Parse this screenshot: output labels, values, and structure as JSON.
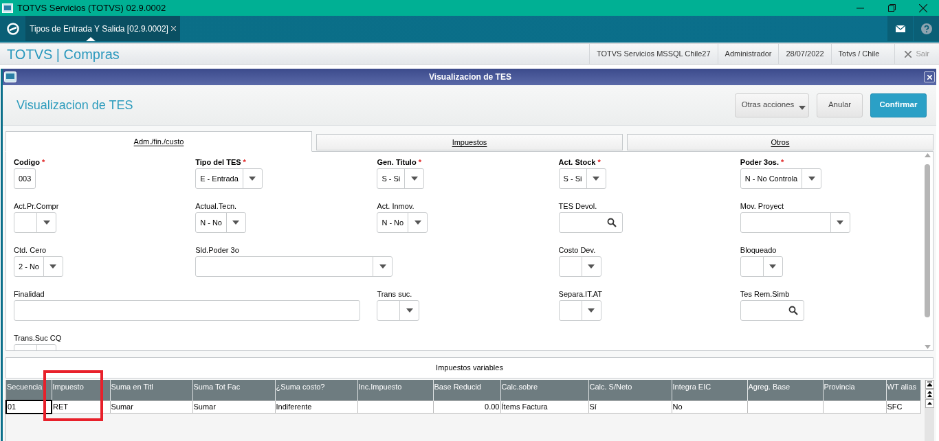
{
  "window": {
    "title": "TOTVS Servicios (TOTVS) 02.9.0002"
  },
  "app_tabs": [
    {
      "label": "Tipos de Entrada Y Salida [02.9.0002]",
      "selected": true
    }
  ],
  "header": {
    "title": "TOTVS | Compras",
    "info": [
      "TOTVS Servicios MSSQL Chile27",
      "Administrador",
      "28/07/2022",
      "Totvs / Chile"
    ],
    "exit": "Sair"
  },
  "dialog": {
    "title": "Visualizacion de TES",
    "heading": "Visualizacion de TES",
    "buttons": [
      {
        "label": "Otras acciones",
        "kind": "menu"
      },
      {
        "label": "Anular",
        "kind": "plain"
      },
      {
        "label": "Confirmar",
        "kind": "primary"
      }
    ]
  },
  "tabs": [
    {
      "label": "Adm./fin./custo",
      "selected": true
    },
    {
      "label": "Impuestos",
      "selected": false
    },
    {
      "label": "Otros",
      "selected": false
    }
  ],
  "fields": [
    {
      "label": "Codigo",
      "required_mark": "*",
      "kind": "text",
      "value": "003"
    },
    {
      "label": "Tipo del TES",
      "required_mark": "*",
      "kind": "select",
      "value": "E - Entrada"
    },
    {
      "label": "Gen. Titulo",
      "required_mark": "*",
      "kind": "select",
      "value": "S - Si"
    },
    {
      "label": "Act. Stock",
      "required_mark": "*",
      "kind": "select",
      "value": "S - Si"
    },
    {
      "label": "Poder 3os.",
      "required_mark": "*",
      "kind": "select",
      "value": "N - No Controla"
    },
    {
      "label": "Act.Pr.Compr",
      "kind": "select"
    },
    {
      "label": "Actual.Tecn.",
      "kind": "select",
      "value": "N - No"
    },
    {
      "label": "Act. Inmov.",
      "kind": "select",
      "value": "N - No"
    },
    {
      "label": "TES Devol.",
      "kind": "lookup"
    },
    {
      "label": "Mov. Proyect",
      "kind": "select-long"
    },
    {
      "label": "Ctd. Cero",
      "kind": "select",
      "value": "2 - No"
    },
    {
      "label": "Sld.Poder 3o",
      "kind": "select-wide"
    },
    {
      "label": "Costo Dev.",
      "kind": "select"
    },
    {
      "label": "Bloqueado",
      "kind": "select"
    },
    {
      "label": "Finalidad",
      "kind": "text-wide"
    },
    {
      "label": "Trans suc.",
      "kind": "select"
    },
    {
      "label": "Separa.IT.AT",
      "kind": "select"
    },
    {
      "label": "Tes Rem.Simb",
      "kind": "lookup"
    },
    {
      "label": "Trans.Suc CQ",
      "kind": "select"
    }
  ],
  "grid": {
    "title": "Impuestos variables",
    "columns": [
      {
        "label": "Secuencia",
        "highlighted": false
      },
      {
        "label": "Impuesto",
        "highlighted": true
      },
      {
        "label": "Suma en Titl",
        "highlighted": false
      },
      {
        "label": "Suma Tot Fac",
        "highlighted": false
      },
      {
        "label": "¿Suma costo?",
        "highlighted": false
      },
      {
        "label": "Inc.Impuesto",
        "highlighted": false
      },
      {
        "label": "Base Reducid",
        "highlighted": false
      },
      {
        "label": "Calc.sobre",
        "highlighted": false
      },
      {
        "label": "Calc. S/Neto",
        "highlighted": false
      },
      {
        "label": "Integra EIC",
        "highlighted": false
      },
      {
        "label": "Agreg. Base",
        "highlighted": false
      },
      {
        "label": "Provincia",
        "highlighted": false
      },
      {
        "label": "WT alias",
        "highlighted": false
      }
    ],
    "rows": [
      {
        "cells": [
          {
            "text": "01",
            "focused": true
          },
          {
            "text": "RET",
            "focused": false
          },
          {
            "text": "Sumar",
            "focused": false
          },
          {
            "text": "Sumar",
            "focused": false
          },
          {
            "text": "Indiferente",
            "focused": false
          },
          {
            "text": "",
            "focused": false
          },
          {
            "text": "0.00",
            "focused": false
          },
          {
            "text": "Ítems Factura",
            "focused": false
          },
          {
            "text": "Sí",
            "focused": false
          },
          {
            "text": "No",
            "focused": false
          },
          {
            "text": "",
            "focused": false
          },
          {
            "text": "",
            "focused": false
          },
          {
            "text": "SFC",
            "focused": false
          }
        ]
      }
    ]
  }
}
